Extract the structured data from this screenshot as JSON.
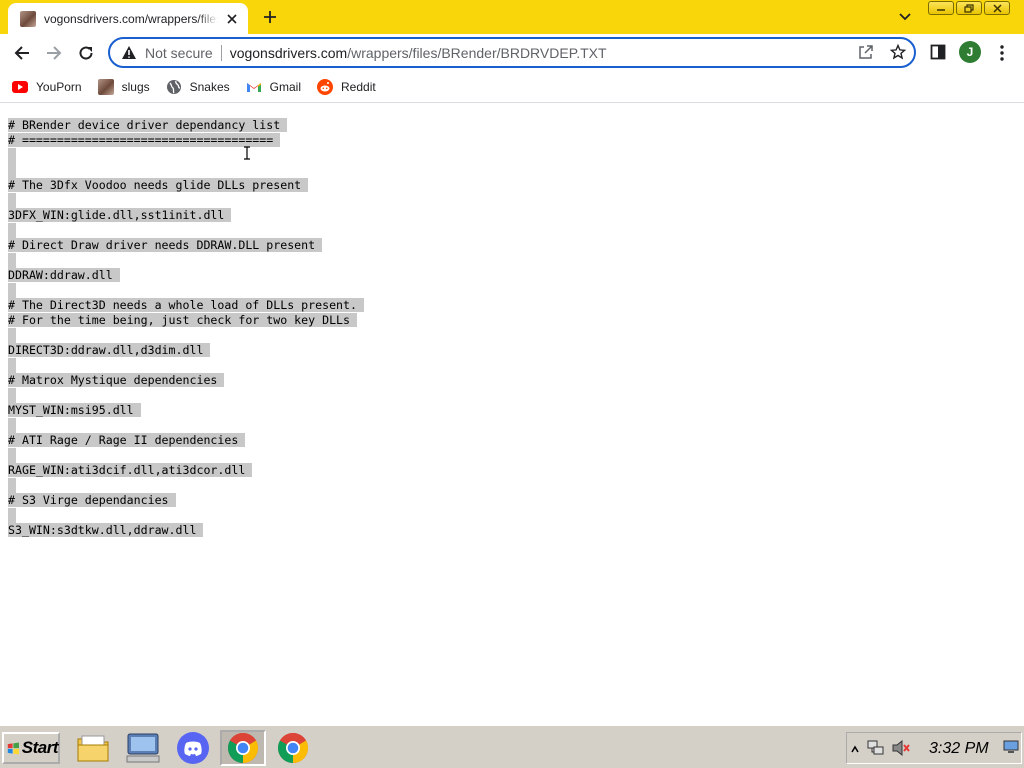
{
  "browser": {
    "tab": {
      "title": "vogonsdrivers.com/wrappers/files/BRender/BRDRVDEP.TXT"
    },
    "omnibox": {
      "security_label": "Not secure",
      "url_host": "vogonsdrivers.com",
      "url_path": "/wrappers/files/BRender/BRDRVDEP.TXT"
    },
    "profile_initial": "J",
    "bookmarks": [
      {
        "label": "YouPorn",
        "icon": "youtube-red-play-icon"
      },
      {
        "label": "slugs",
        "icon": "image-favicon"
      },
      {
        "label": "Snakes",
        "icon": "globe-icon"
      },
      {
        "label": "Gmail",
        "icon": "gmail-icon"
      },
      {
        "label": "Reddit",
        "icon": "reddit-icon"
      }
    ],
    "accent_color": "#f9d60a"
  },
  "document": {
    "lines": [
      "# BRender device driver dependancy list",
      "# ====================================",
      "",
      "",
      "# The 3Dfx Voodoo needs glide DLLs present",
      "",
      "3DFX_WIN:glide.dll,sst1init.dll",
      "",
      "# Direct Draw driver needs DDRAW.DLL present",
      "",
      "DDRAW:ddraw.dll",
      "",
      "# The Direct3D needs a whole load of DLLs present.",
      "# For the time being, just check for two key DLLs",
      "",
      "DIRECT3D:ddraw.dll,d3dim.dll",
      "",
      "# Matrox Mystique dependencies",
      "",
      "MYST_WIN:msi95.dll",
      "",
      "# ATI Rage / Rage II dependencies",
      "",
      "RAGE_WIN:ati3dcif.dll,ati3dcor.dll",
      "",
      "# S3 Virge dependancies",
      "",
      "S3_WIN:s3dtkw.dll,ddraw.dll"
    ]
  },
  "taskbar": {
    "start_label": "Start",
    "clock": "3:32 PM",
    "apps": [
      "file-explorer-icon",
      "computer-icon",
      "discord-icon",
      "chrome-icon",
      "chrome-icon"
    ]
  }
}
